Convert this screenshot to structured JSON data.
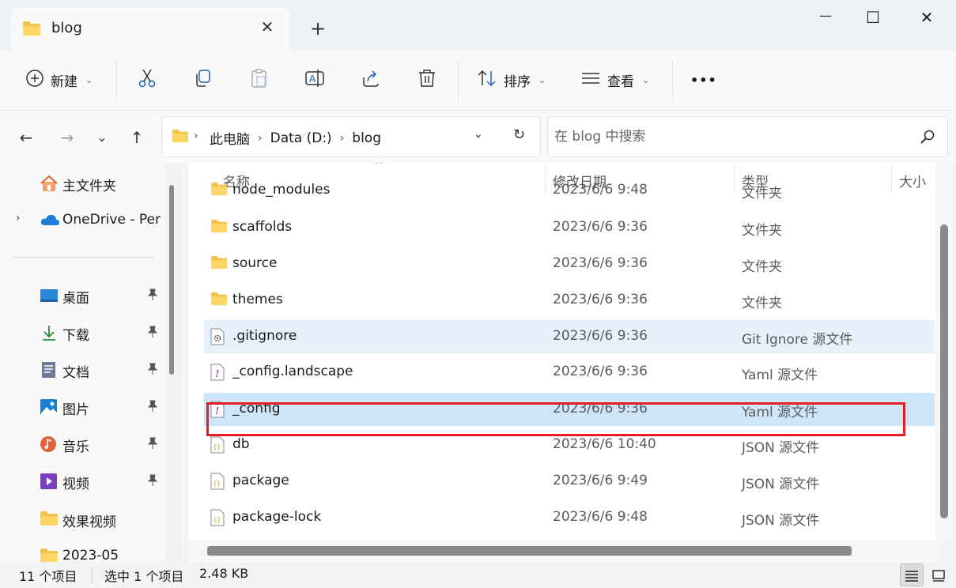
{
  "window": {
    "tab_title": "blog",
    "tab_close": "✕",
    "new_tab": "+",
    "minimize": "—",
    "maximize": "☐",
    "close": "✕"
  },
  "toolbar": {
    "new_label": "新建",
    "sort_label": "排序",
    "view_label": "查看",
    "more_label": "•••"
  },
  "address": {
    "crumbs": [
      "此电脑",
      "Data (D:)",
      "blog"
    ],
    "search_placeholder": "在 blog 中搜索"
  },
  "nav": {
    "home": "主文件夹",
    "onedrive": "OneDrive - Per",
    "items": [
      {
        "label": "桌面",
        "icon": "desktop-icon",
        "color": "#2a86d9"
      },
      {
        "label": "下载",
        "icon": "download-icon",
        "color": "#2a8c3a"
      },
      {
        "label": "文档",
        "icon": "document-icon",
        "color": "#6b7c99"
      },
      {
        "label": "图片",
        "icon": "picture-icon",
        "color": "#1b7fd6"
      },
      {
        "label": "音乐",
        "icon": "music-icon",
        "color": "#e3623e"
      },
      {
        "label": "视频",
        "icon": "video-icon",
        "color": "#7a3ec0"
      }
    ],
    "folders": [
      "效果视频",
      "2023-05"
    ]
  },
  "columns": {
    "name": "名称",
    "date": "修改日期",
    "type": "类型",
    "size": "大小"
  },
  "files": [
    {
      "name": "node_modules",
      "date": "2023/6/6 9:48",
      "type": "文件夹",
      "icon": "folder-icon"
    },
    {
      "name": "scaffolds",
      "date": "2023/6/6 9:36",
      "type": "文件夹",
      "icon": "folder-icon"
    },
    {
      "name": "source",
      "date": "2023/6/6 9:36",
      "type": "文件夹",
      "icon": "folder-icon"
    },
    {
      "name": "themes",
      "date": "2023/6/6 9:36",
      "type": "文件夹",
      "icon": "folder-icon"
    },
    {
      "name": ".gitignore",
      "date": "2023/6/6 9:36",
      "type": "Git Ignore 源文件",
      "icon": "gear-file-icon"
    },
    {
      "name": "_config.landscape",
      "date": "2023/6/6 9:36",
      "type": "Yaml 源文件",
      "icon": "yaml-file-icon"
    },
    {
      "name": "_config",
      "date": "2023/6/6 9:36",
      "type": "Yaml 源文件",
      "icon": "yaml-file-icon"
    },
    {
      "name": "db",
      "date": "2023/6/6 10:40",
      "type": "JSON 源文件",
      "icon": "json-file-icon"
    },
    {
      "name": "package",
      "date": "2023/6/6 9:49",
      "type": "JSON 源文件",
      "icon": "json-file-icon"
    },
    {
      "name": "package-lock",
      "date": "2023/6/6 9:48",
      "type": "JSON 源文件",
      "icon": "json-file-icon"
    }
  ],
  "status": {
    "count": "11 个项目",
    "selected": "选中 1 个项目",
    "size": "2.48 KB"
  },
  "colors": {
    "folder": "#f3c24b",
    "selection": "#cde6fa",
    "highlight_box": "#e81d24",
    "accent": "#0067c0"
  }
}
